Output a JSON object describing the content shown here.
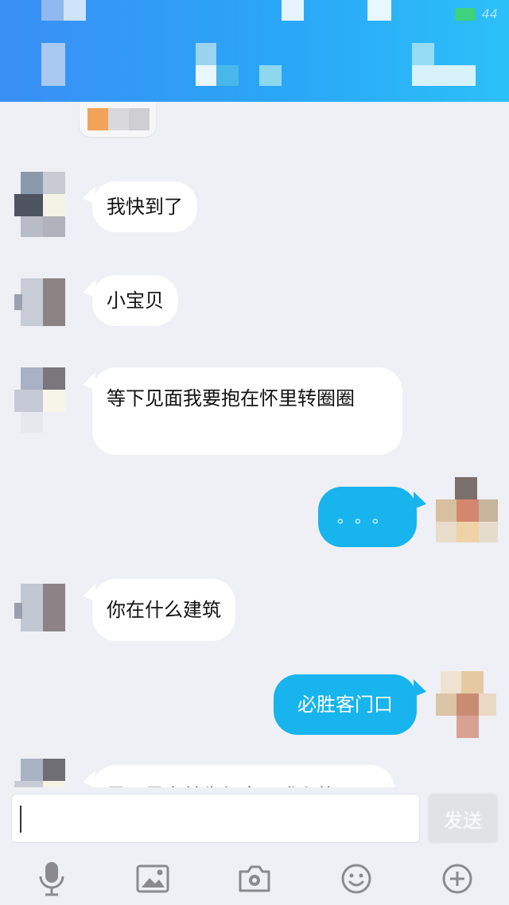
{
  "header": {
    "status_glyph": "44"
  },
  "messages": [
    {
      "direction": "in",
      "text": "我快到了"
    },
    {
      "direction": "in",
      "text": "小宝贝"
    },
    {
      "direction": "in",
      "text": "等下见面我要抱在怀里转圈圈"
    },
    {
      "direction": "out",
      "text": "。。。"
    },
    {
      "direction": "in",
      "text": "你在什么建筑"
    },
    {
      "direction": "out",
      "text": "必胜客门口"
    },
    {
      "direction": "in",
      "text": "是不是宾美先红文一戏么的"
    }
  ],
  "input": {
    "value": "",
    "send_label": "发送"
  },
  "toolbar": {
    "icons": [
      "microphone-icon",
      "image-icon",
      "camera-icon",
      "emoji-icon",
      "plus-icon"
    ]
  },
  "colors": {
    "header_start": "#3a8ff5",
    "header_end": "#2cc0f8",
    "background": "#eff0f5",
    "incoming_bubble": "#ffffff",
    "outgoing_bubble": "#17b4ee",
    "icon_gray": "#8a8a8f"
  }
}
